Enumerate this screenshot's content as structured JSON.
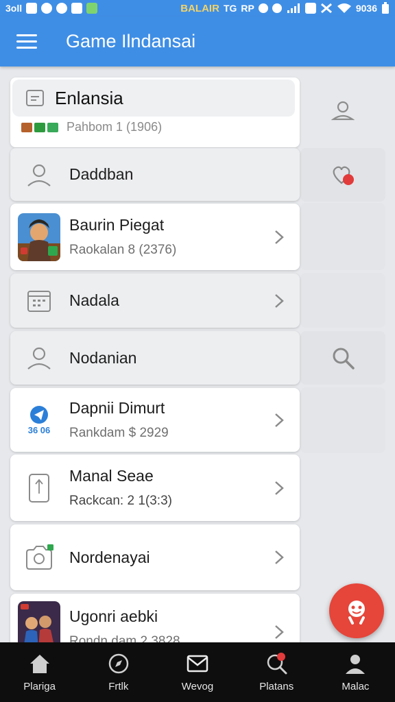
{
  "status_bar": {
    "left_text": "3oll",
    "carrier": "BALAIR",
    "network": "TG",
    "mid_text": "RP",
    "battery": "9036"
  },
  "app_bar": {
    "title": "Game Ilndansai",
    "menu_icon": "hamburger-menu-icon"
  },
  "list": {
    "header_card": {
      "title": "Enlansia",
      "subtitle": "Pahbom 1 (1906)"
    },
    "items": [
      {
        "title": "Daddban",
        "icon": "person-outline-icon"
      },
      {
        "title": "Baurin Piegat",
        "subtitle": "Raokalan 8 (2376)",
        "icon": "game-thumbnail-warrior"
      },
      {
        "title": "Nadala",
        "icon": "calendar-grid-icon"
      },
      {
        "title": "Nodanian",
        "icon": "person-outline-icon"
      },
      {
        "title": "Dapnii Dimurt",
        "subtitle": "Rankdam $ 2929",
        "icon": "telegram-style-badge-icon",
        "icon_text": "36 06"
      },
      {
        "title": "Manal Seae",
        "subtitle": "Rackcan: 2 1(3:3)",
        "icon": "phone-outline-icon"
      },
      {
        "title": "Nordenayai",
        "icon": "camera-outline-icon"
      },
      {
        "title": "Ugonri aebki",
        "subtitle": "Rondn.dam 2 3828",
        "icon": "game-thumbnail-heroes"
      }
    ]
  },
  "right_column": {
    "icons": [
      "person-outline-icon",
      "heart-badge-icon",
      "search-icon"
    ]
  },
  "fab": {
    "icon": "mascot-face-icon"
  },
  "bottom_nav": {
    "items": [
      {
        "label": "Plariga",
        "icon": "home-icon"
      },
      {
        "label": "Frtlk",
        "icon": "compass-icon"
      },
      {
        "label": "Wevog",
        "icon": "envelope-icon"
      },
      {
        "label": "Platans",
        "icon": "search-badge-icon"
      },
      {
        "label": "Malac",
        "icon": "profile-icon"
      }
    ]
  },
  "colors": {
    "app_bar": "#3f8ee5",
    "fab": "#e6453a",
    "bottom_nav": "#0e0e0e",
    "background": "#e6e8eb"
  }
}
